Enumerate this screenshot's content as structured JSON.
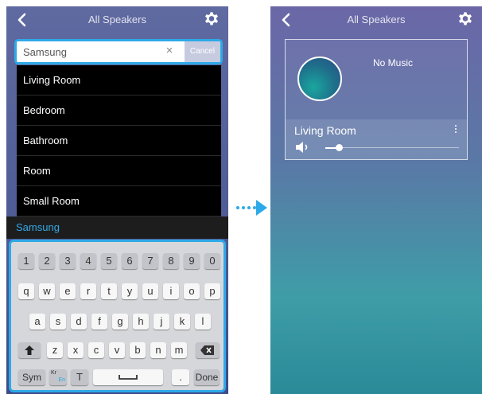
{
  "left_screen": {
    "title": "All Speakers",
    "search": {
      "value": "Samsung",
      "clear_glyph": "×",
      "cancel_label": "Cancel"
    },
    "suggestions": [
      "Living Room",
      "Bedroom",
      "Bathroom",
      "Room",
      "Small Room"
    ],
    "keyboard": {
      "suggestion": "Samsung",
      "row_numbers": [
        "1",
        "2",
        "3",
        "4",
        "5",
        "6",
        "7",
        "8",
        "9",
        "0"
      ],
      "row_1": [
        "q",
        "w",
        "e",
        "r",
        "t",
        "y",
        "u",
        "i",
        "o",
        "p"
      ],
      "row_2": [
        "a",
        "s",
        "d",
        "f",
        "g",
        "h",
        "j",
        "k",
        "l"
      ],
      "row_3": [
        "z",
        "x",
        "c",
        "v",
        "b",
        "n",
        "m"
      ],
      "sym_label": "Sym",
      "lang_top": "Kr",
      "lang_bottom": "En",
      "handwriting_label": "T",
      "period_label": ".",
      "done_label": "Done"
    }
  },
  "right_screen": {
    "title": "All Speakers",
    "card": {
      "status": "No Music",
      "speaker_name": "Living Room",
      "volume_fraction": 0.1
    }
  },
  "colors": {
    "accent": "#2ea9e8"
  },
  "icons": [
    "back-icon",
    "gear-icon",
    "backspace-icon",
    "shift-icon",
    "space-icon",
    "volume-icon",
    "more-icon"
  ]
}
